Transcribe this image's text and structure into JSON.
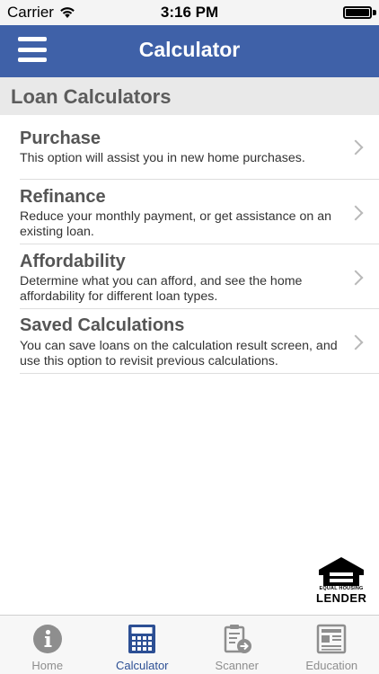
{
  "status_bar": {
    "carrier": "Carrier",
    "time": "3:16 PM",
    "battery_level": 1.0
  },
  "nav_bar": {
    "title": "Calculator",
    "menu_icon": "hamburger-menu-icon",
    "background_color": "#3f61a8"
  },
  "section": {
    "title": "Loan Calculators"
  },
  "list": {
    "items": [
      {
        "title": "Purchase",
        "description": "This option will assist you in new home purchases."
      },
      {
        "title": "Refinance",
        "description": "Reduce your monthly payment, or get assistance on an existing loan."
      },
      {
        "title": "Affordability",
        "description": "Determine what you can afford, and see the home affordability for different loan types."
      },
      {
        "title": "Saved Calculations",
        "description": "You can save loans on the calculation result screen, and use this option to revisit previous calculations."
      }
    ]
  },
  "logo": {
    "small_text": "EQUAL HOUSING",
    "main_text": "LENDER"
  },
  "tab_bar": {
    "active_tab": "Calculator",
    "active_color": "#2c4f94",
    "tabs": [
      {
        "label": "Home",
        "icon": "info-icon"
      },
      {
        "label": "Calculator",
        "icon": "calculator-icon"
      },
      {
        "label": "Scanner",
        "icon": "scanner-icon"
      },
      {
        "label": "Education",
        "icon": "newspaper-icon"
      }
    ]
  }
}
